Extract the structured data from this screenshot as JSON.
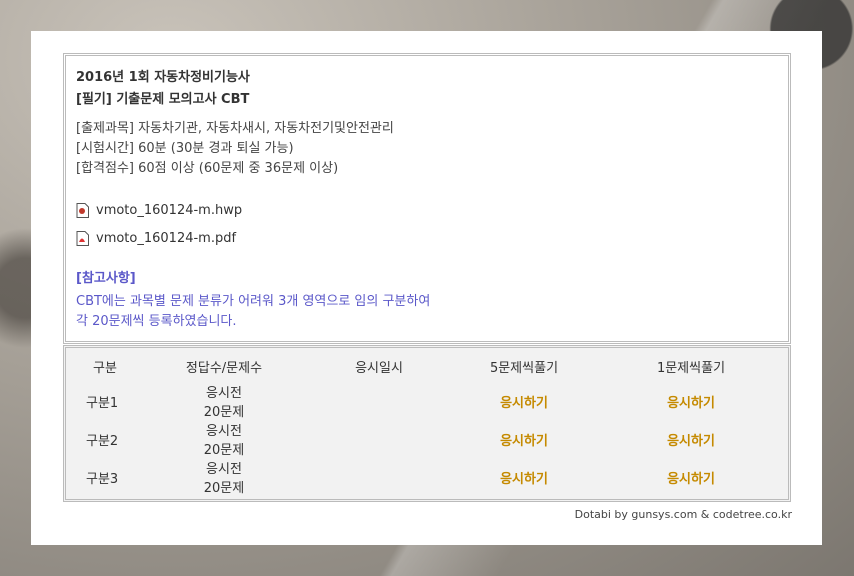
{
  "header": {
    "title_line1": "2016년 1회 자동차정비기능사",
    "title_line2": "[필기] 기출문제 모의고사 CBT"
  },
  "info": [
    "[출제과목] 자동차기관, 자동차새시, 자동차전기및안전관리",
    "[시험시간] 60분 (30분 경과 퇴실 가능)",
    "[합격점수] 60점 이상 (60문제 중 36문제 이상)"
  ],
  "files": [
    {
      "name": "vmoto_160124-m.hwp",
      "icon": "hwp-file-icon"
    },
    {
      "name": "vmoto_160124-m.pdf",
      "icon": "pdf-file-icon"
    }
  ],
  "note": {
    "title": "[참고사항]",
    "line1": "CBT에는 과목별 문제 분류가 어려워 3개 영역으로 임의 구분하여",
    "line2": "각 20문제씩 등록하였습니다."
  },
  "table": {
    "headers": [
      "구분",
      "정답수/문제수",
      "응시일시",
      "5문제씩풀기",
      "1문제씩풀기"
    ],
    "rows": [
      {
        "section": "구분1",
        "status": "응시전",
        "count": "20문제",
        "date": "",
        "five": "응시하기",
        "one": "응시하기"
      },
      {
        "section": "구분2",
        "status": "응시전",
        "count": "20문제",
        "date": "",
        "five": "응시하기",
        "one": "응시하기"
      },
      {
        "section": "구분3",
        "status": "응시전",
        "count": "20문제",
        "date": "",
        "five": "응시하기",
        "one": "응시하기"
      }
    ]
  },
  "footer": "Dotabi by gunsys.com & codetree.co.kr",
  "colors": {
    "note": "#5b58c9",
    "action": "#c58a00"
  }
}
